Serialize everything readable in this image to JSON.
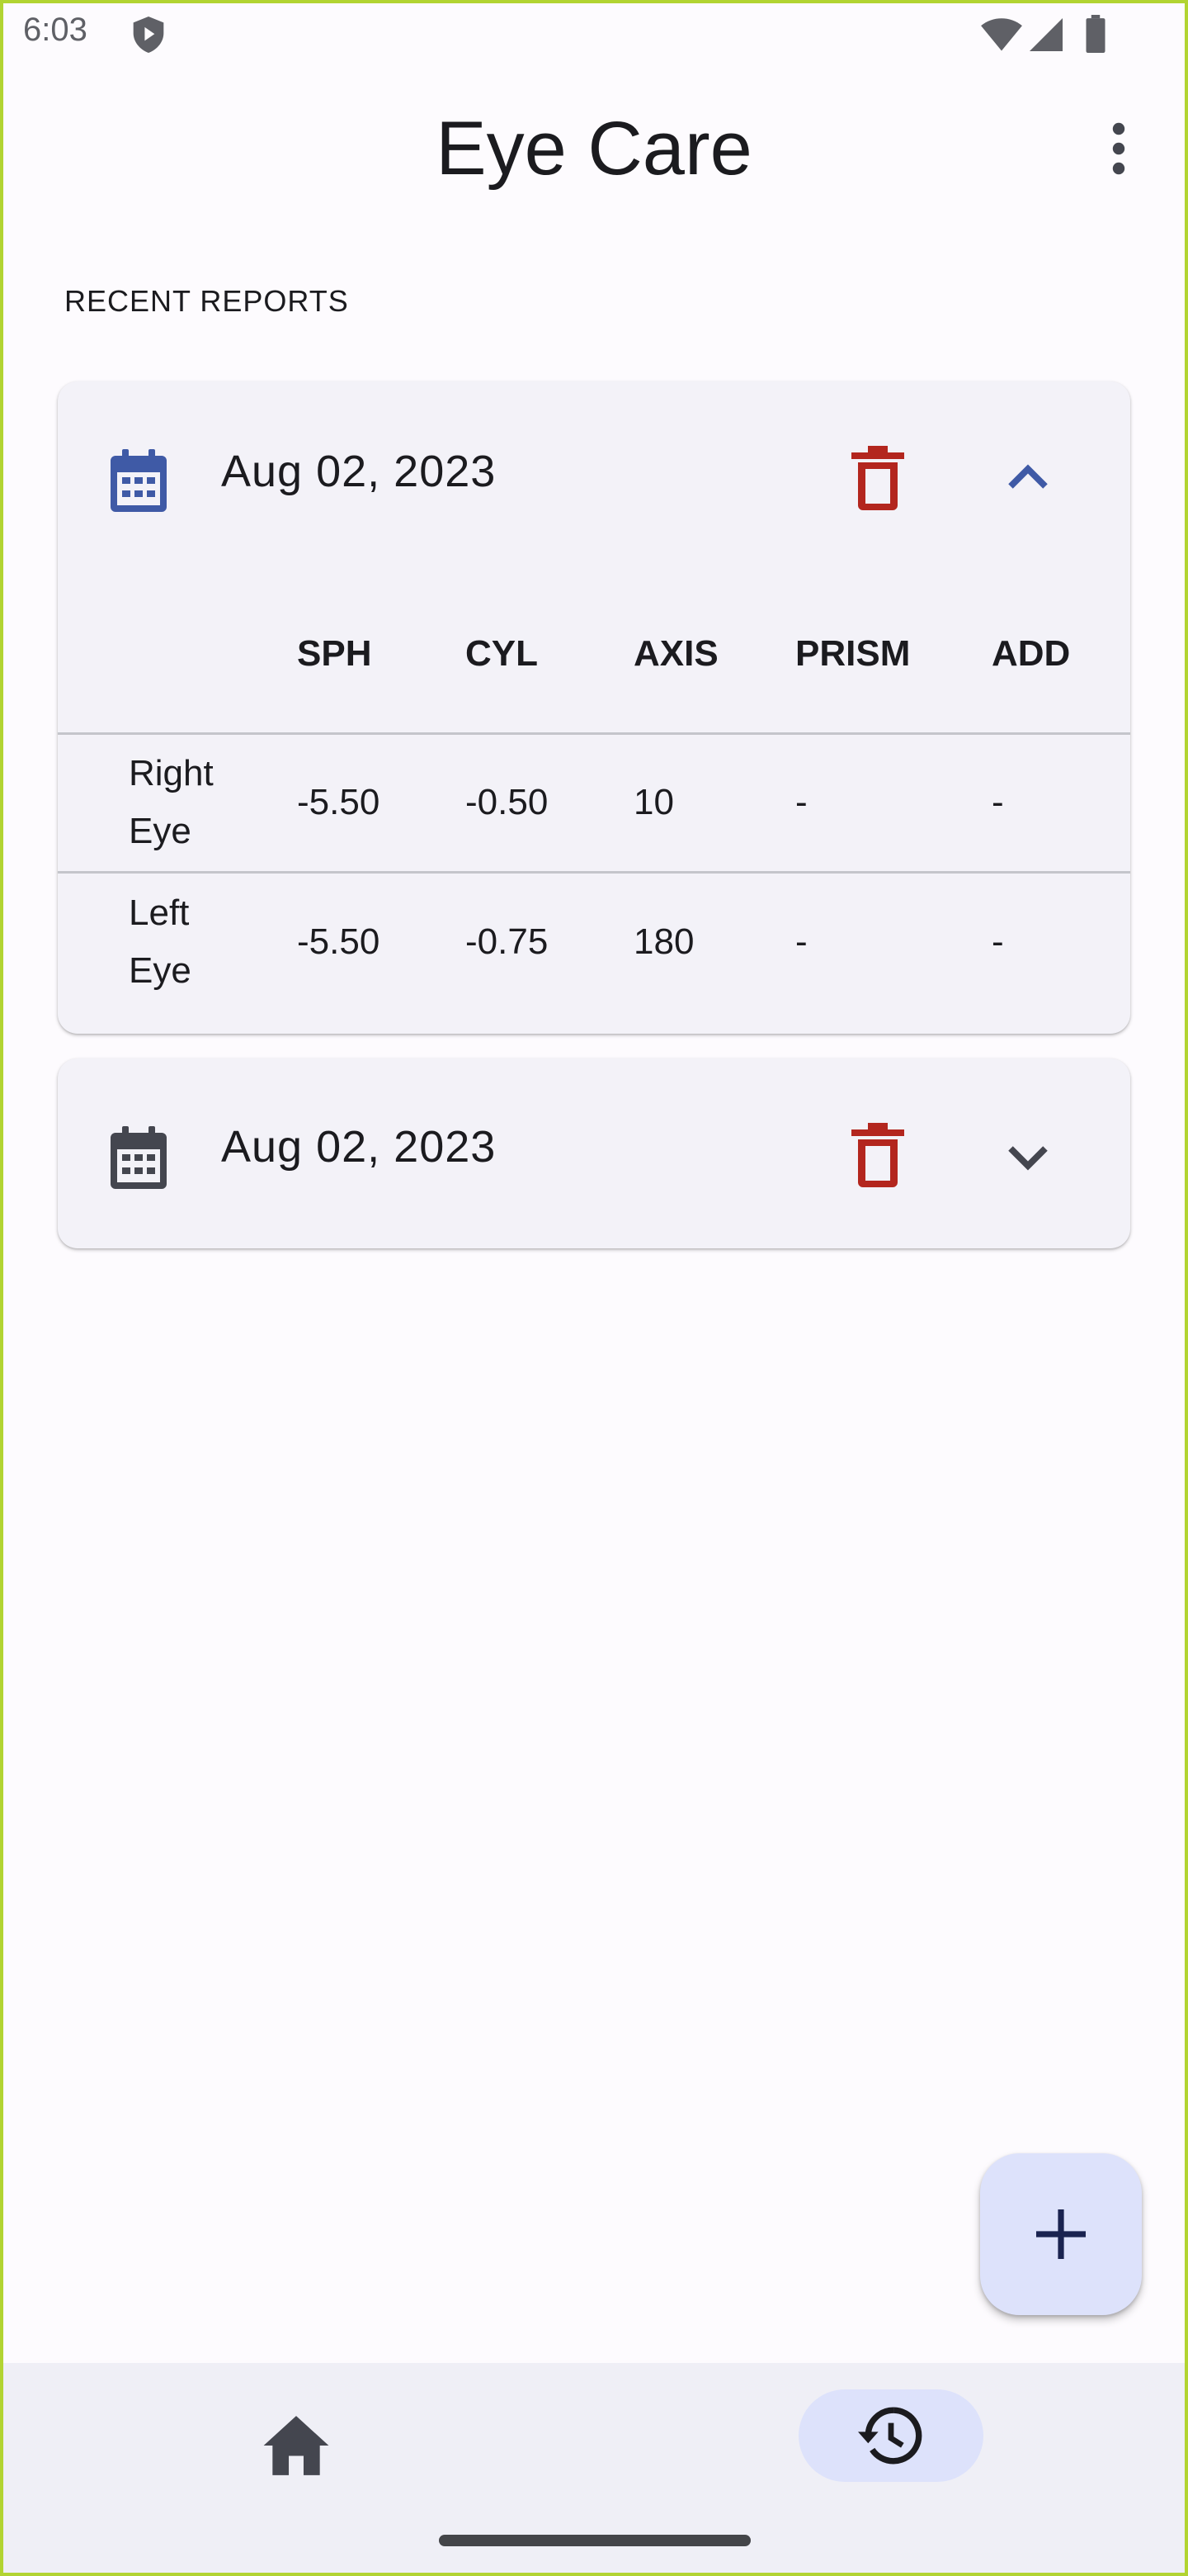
{
  "status_bar": {
    "time": "6:03",
    "icons": [
      "shield-play-icon",
      "wifi-icon",
      "signal-icon",
      "battery-icon"
    ]
  },
  "app_bar": {
    "title": "Eye Care",
    "menu_icon": "more-vert-icon"
  },
  "section": {
    "label": "RECENT REPORTS"
  },
  "reports": [
    {
      "date": "Aug 02, 2023",
      "expanded": true,
      "calendar_icon_color": "#3f5aa6",
      "columns": [
        "",
        "SPH",
        "CYL",
        "AXIS",
        "PRISM",
        "ADD"
      ],
      "rows": [
        {
          "eye": "Right Eye",
          "sph": "-5.50",
          "cyl": "-0.50",
          "axis": "10",
          "prism": "-",
          "add": "-"
        },
        {
          "eye": "Left Eye",
          "sph": "-5.50",
          "cyl": "-0.75",
          "axis": "180",
          "prism": "-",
          "add": "-"
        }
      ]
    },
    {
      "date": "Aug 02, 2023",
      "expanded": false,
      "calendar_icon_color": "#44464f"
    }
  ],
  "fab": {
    "icon": "add-icon"
  },
  "bottom_nav": {
    "items": [
      {
        "icon": "home-icon",
        "selected": false
      },
      {
        "icon": "history-icon",
        "selected": true
      }
    ]
  },
  "colors": {
    "background": "#fdfbfe",
    "card": "#f3f2f8",
    "delete": "#b3261e",
    "accent_container": "#dde2fb",
    "primary": "#3f5aa6",
    "device_frame": "#b2d432"
  }
}
